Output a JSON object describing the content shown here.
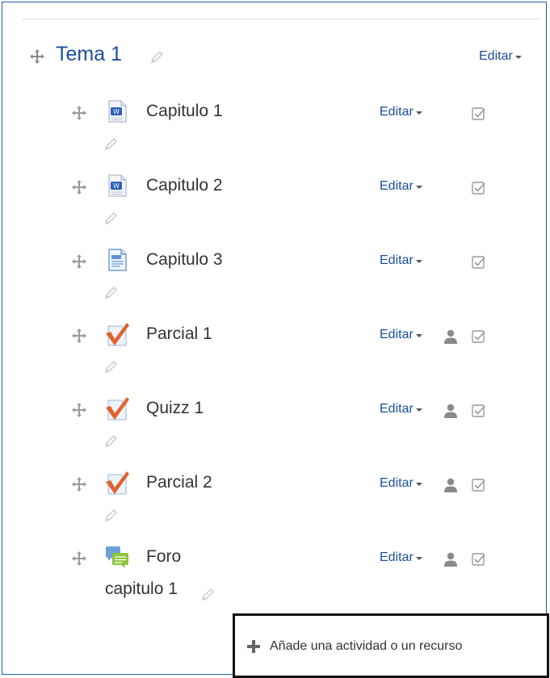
{
  "section": {
    "title": "Tema 1",
    "edit_label": "Editar"
  },
  "activities": [
    {
      "name": "Capitulo 1",
      "icon": "word-document-icon",
      "edit_label": "Editar",
      "has_user_icon": false
    },
    {
      "name": "Capitulo 2",
      "icon": "word-document-icon",
      "edit_label": "Editar",
      "has_user_icon": false
    },
    {
      "name": "Capitulo 3",
      "icon": "page-document-icon",
      "edit_label": "Editar",
      "has_user_icon": false
    },
    {
      "name": "Parcial 1",
      "icon": "quiz-icon",
      "edit_label": "Editar",
      "has_user_icon": true
    },
    {
      "name": "Quizz 1",
      "icon": "quiz-icon",
      "edit_label": "Editar",
      "has_user_icon": true
    },
    {
      "name": "Parcial 2",
      "icon": "quiz-icon",
      "edit_label": "Editar",
      "has_user_icon": true
    },
    {
      "name_line1": "Foro",
      "name_line2": "capitulo 1",
      "icon": "forum-icon",
      "edit_label": "Editar",
      "has_user_icon": true
    }
  ],
  "add_activity": {
    "label": "Añade una actividad o un recurso"
  },
  "colors": {
    "link": "#1b4f9c",
    "frame": "#1f5fa8",
    "quiz_check": "#e0622d"
  }
}
